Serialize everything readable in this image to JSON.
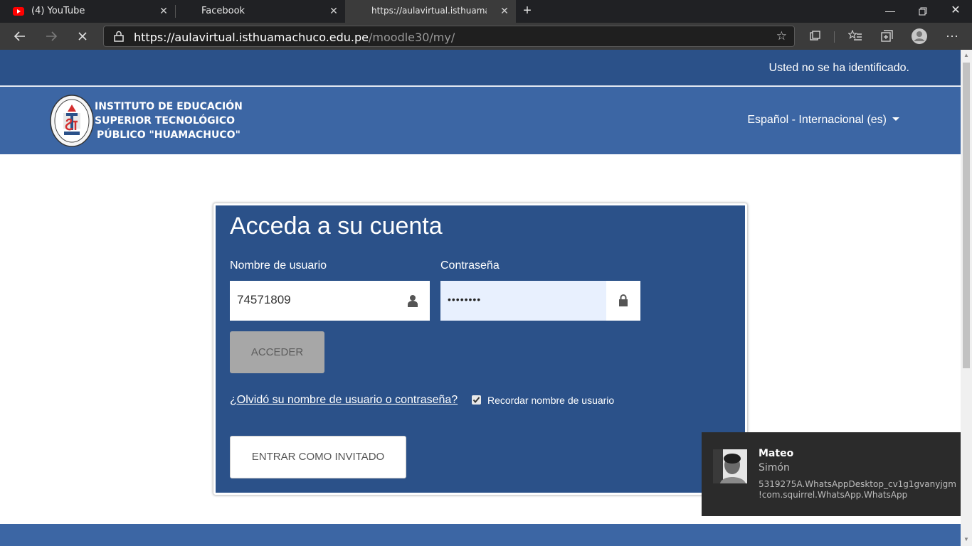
{
  "browser": {
    "tabs": [
      {
        "title": "(4) YouTube",
        "icon": "youtube-icon"
      },
      {
        "title": "Facebook",
        "icon": ""
      },
      {
        "title": "https://aulavirtual.isthuamachuco.edu.pe/moodle30/my/",
        "icon": ""
      }
    ],
    "url": {
      "host": "https://aulavirtual.isthuamachuco.edu.pe",
      "path": "/moodle30/my/"
    }
  },
  "site": {
    "login_status": "Usted no se ha identificado.",
    "institution": {
      "line1": "INSTITUTO DE EDUCACIÓN",
      "line2": "SUPERIOR TECNOLÓGICO",
      "line3": "PÚBLICO \"HUAMACHUCO\""
    },
    "language": "Español - Internacional (es)"
  },
  "login": {
    "title": "Acceda a su cuenta",
    "username_label": "Nombre de usuario",
    "username_value": "74571809",
    "password_label": "Contraseña",
    "password_mask": "••••••••",
    "submit_label": "ACCEDER",
    "forgot_link": "¿Olvidó su nombre de usuario o contraseña?",
    "remember_label": "Recordar nombre de usuario",
    "remember_checked": true,
    "guest_label": "ENTRAR COMO INVITADO"
  },
  "notification": {
    "sender": "Mateo",
    "message": "Simón",
    "app_line1": "5319275A.WhatsAppDesktop_cv1g1gvanyjgm",
    "app_line2": "!com.squirrel.WhatsApp.WhatsApp"
  },
  "colors": {
    "topbar": "#2b5189",
    "header": "#3c66a4",
    "card": "#2b5189",
    "browser_dark": "#202124"
  }
}
